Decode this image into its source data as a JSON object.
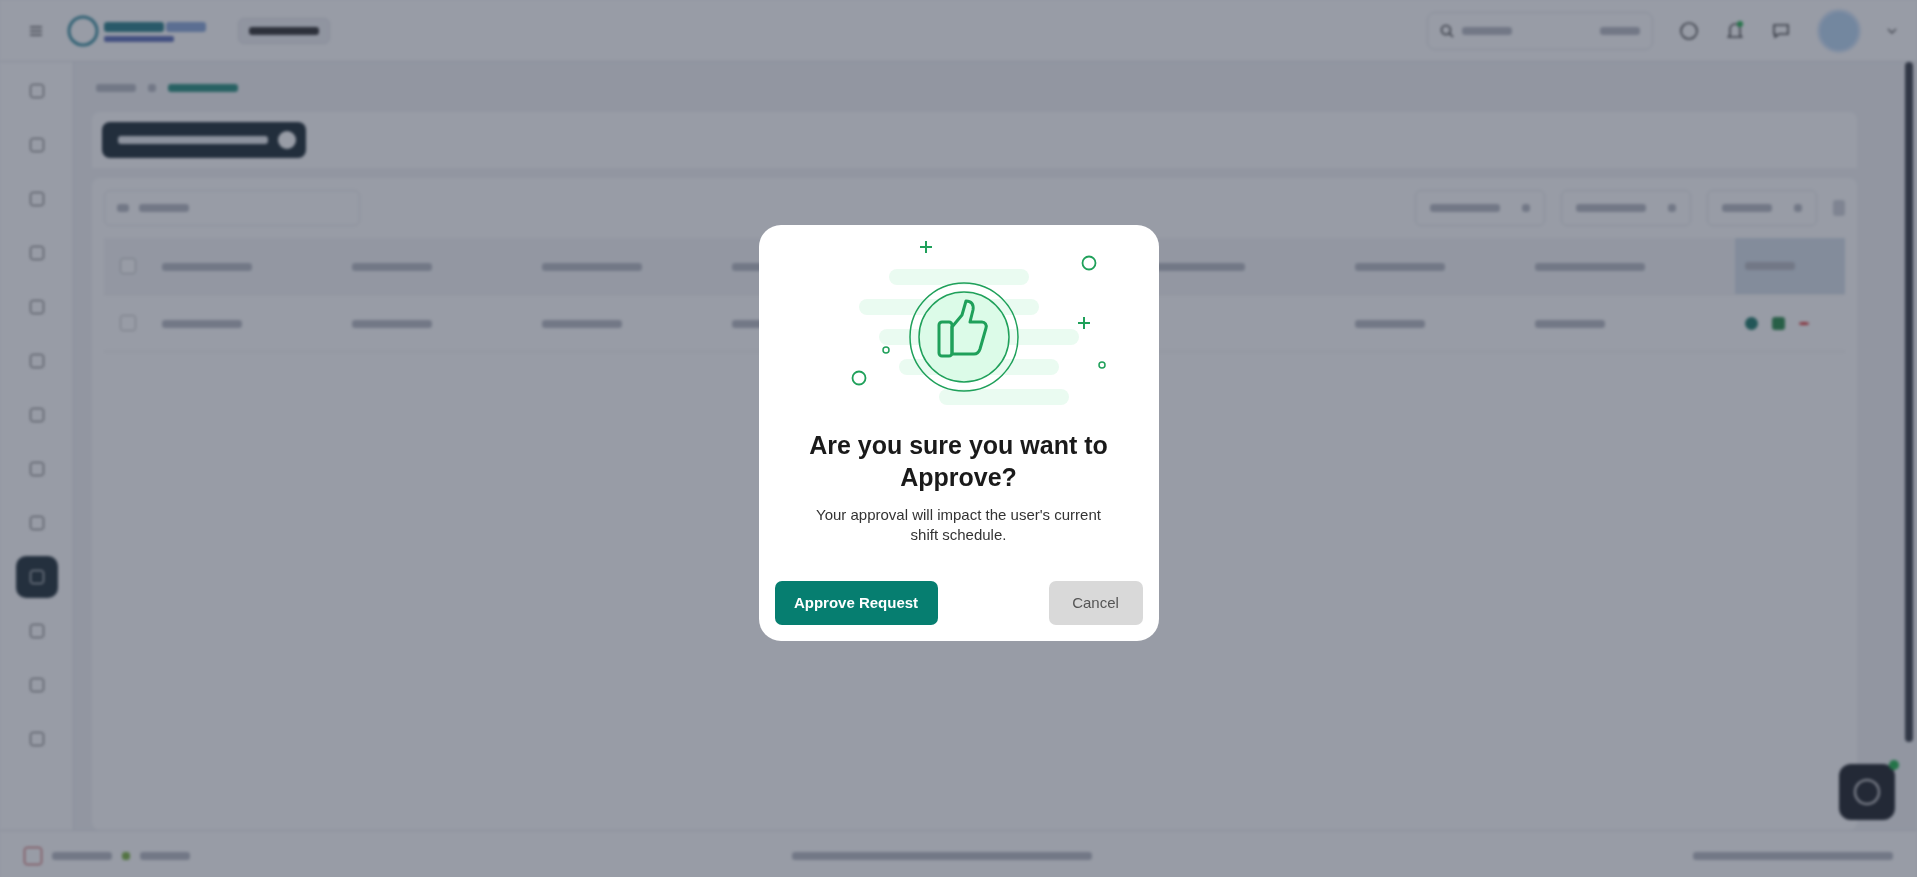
{
  "dialog": {
    "title": "Are you sure you want to Approve?",
    "message": "Your approval will impact the user's current shift schedule.",
    "buttons": [
      {
        "label": "Approve Request",
        "kind": "primary"
      },
      {
        "label": "Cancel",
        "kind": "secondary"
      }
    ]
  }
}
